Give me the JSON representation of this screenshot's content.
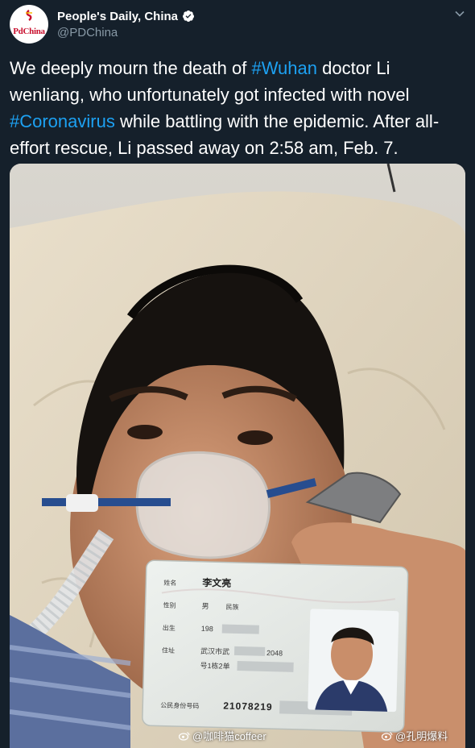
{
  "header": {
    "display_name": "People's Daily, China",
    "handle": "@PDChina",
    "avatar_logo_text": "PdChina",
    "verified_icon": "verified-badge-icon",
    "more_icon": "chevron-down-icon"
  },
  "tweet": {
    "segments": [
      {
        "text": "We deeply mourn the death of ",
        "hashtag": false
      },
      {
        "text": "#Wuhan",
        "hashtag": true
      },
      {
        "text": " doctor Li wenliang, who unfortunately got infected with novel ",
        "hashtag": false
      },
      {
        "text": "#Coronavirus",
        "hashtag": true
      },
      {
        "text": " while battling with the epidemic. After all-effort rescue, Li passed away on 2:58 am, Feb. 7.",
        "hashtag": false
      }
    ]
  },
  "id_card": {
    "name": "李文亮",
    "sex": "男",
    "birth_prefix": "198",
    "address": "武汉市武",
    "address_tail": "2048",
    "address_line2": "号1栋2单",
    "id_number_label": "公民身份号码",
    "id_number_prefix": "21078219",
    "field_labels": [
      "姓名",
      "性别",
      "民族",
      "出生",
      "住址"
    ]
  },
  "watermarks": [
    {
      "text": "@咖啡猫coffeer",
      "icon": "weibo-icon"
    },
    {
      "text": "@孔明爆料",
      "icon": "weibo-icon"
    }
  ],
  "colors": {
    "background": "#15202b",
    "text": "#ffffff",
    "secondary_text": "#8899a6",
    "hashtag": "#1da1f2",
    "verified": "#ffffff",
    "logo_red": "#c8102e"
  }
}
